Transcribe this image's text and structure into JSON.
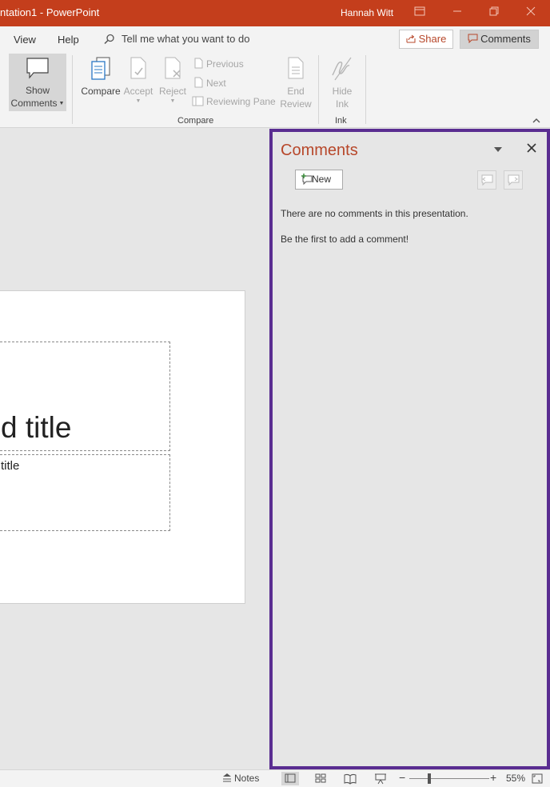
{
  "app": {
    "title": "ntation1  -  PowerPoint",
    "user": "Hannah Witt"
  },
  "tabs": {
    "view": "View",
    "help": "Help",
    "tell_me": "Tell me what you want to do",
    "share": "Share",
    "comments": "Comments"
  },
  "ribbon": {
    "show_comments_line1": "Show",
    "show_comments_line2": "Comments",
    "compare": "Compare",
    "accept": "Accept",
    "reject": "Reject",
    "previous": "Previous",
    "next": "Next",
    "reviewing_pane": "Reviewing Pane",
    "end_review_line1": "End",
    "end_review_line2": "Review",
    "hide_ink_line1": "Hide",
    "hide_ink_line2": "Ink",
    "group_compare": "Compare",
    "group_ink": "Ink"
  },
  "slide": {
    "title_text": "d title",
    "subtitle_text": "title"
  },
  "comments_pane": {
    "title": "Comments",
    "new_button": "New",
    "empty_message": "There are no comments in this presentation.",
    "prompt": "Be the first to add a comment!",
    "border_color": "#5a2d91"
  },
  "statusbar": {
    "notes": "Notes",
    "zoom": "55%"
  },
  "colors": {
    "accent": "#c43e1c",
    "brand_text": "#b7472a"
  }
}
